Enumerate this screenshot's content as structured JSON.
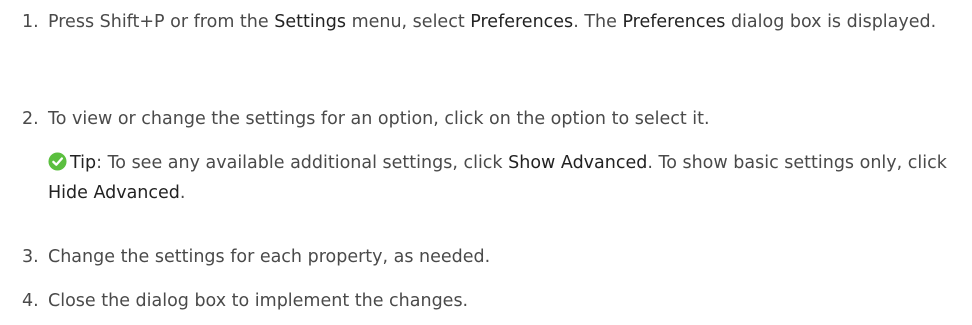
{
  "steps": [
    {
      "number": "1.",
      "part1": "Press Shift+P or from the ",
      "ui1": "Settings",
      "part2": " menu, select ",
      "ui2": "Preferences",
      "part3": ". The ",
      "ui3": "Preferences",
      "part4": " dialog box is displayed."
    },
    {
      "number": "2.",
      "text": "To view or change the settings for an option, click on the option to select it."
    },
    {
      "number": "3.",
      "text": "Change the settings for each property, as needed."
    },
    {
      "number": "4.",
      "text": "Close the dialog box to implement the changes."
    }
  ],
  "tip": {
    "icon": "checkmark-circle-icon",
    "icon_color": "#5bbf3f",
    "label": "Tip",
    "part1": ": To see any available additional settings, click ",
    "ui1": "Show Advanced",
    "part2": ". To show basic settings only, click ",
    "ui2": "Hide Advanced",
    "part3": "."
  }
}
